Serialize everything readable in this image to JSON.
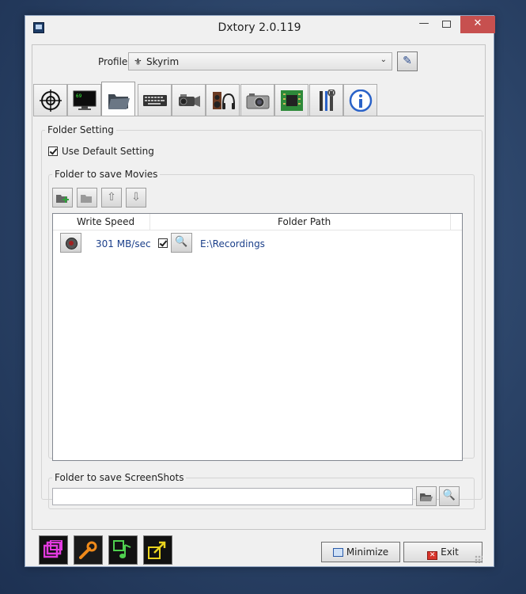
{
  "window": {
    "title": "Dxtory 2.0.119",
    "minimize_glyph": "—",
    "close_glyph": "✕"
  },
  "profile": {
    "label": "Profile",
    "value": "Skyrim",
    "icon": "skyrim-logo-icon",
    "edit_icon": "pencil-icon"
  },
  "tabs": [
    {
      "name": "target-icon"
    },
    {
      "name": "monitor-icon"
    },
    {
      "name": "folder-icon",
      "active": true
    },
    {
      "name": "keyboard-icon"
    },
    {
      "name": "video-camera-icon"
    },
    {
      "name": "audio-icon"
    },
    {
      "name": "camera-icon"
    },
    {
      "name": "chip-icon"
    },
    {
      "name": "tools-icon"
    },
    {
      "name": "info-icon"
    }
  ],
  "folder_setting": {
    "legend": "Folder Setting",
    "use_default_label": "Use Default Setting",
    "use_default_checked": true
  },
  "movies": {
    "legend": "Folder to save Movies",
    "toolbar": [
      "add-folder-icon",
      "remove-folder-icon",
      "move-up-icon",
      "move-down-icon"
    ],
    "columns": [
      "Write Speed",
      "Folder Path"
    ],
    "rows": [
      {
        "write_speed": "301 MB/sec",
        "checked": true,
        "folder_path": "E:\\Recordings"
      }
    ]
  },
  "screenshots": {
    "legend": "Folder to save ScreenShots",
    "path": ""
  },
  "bottom": {
    "minimize_label": "Minimize",
    "exit_label": "Exit"
  },
  "colors": {
    "accent_text": "#1b3f8a",
    "close_button": "#c7504f"
  }
}
